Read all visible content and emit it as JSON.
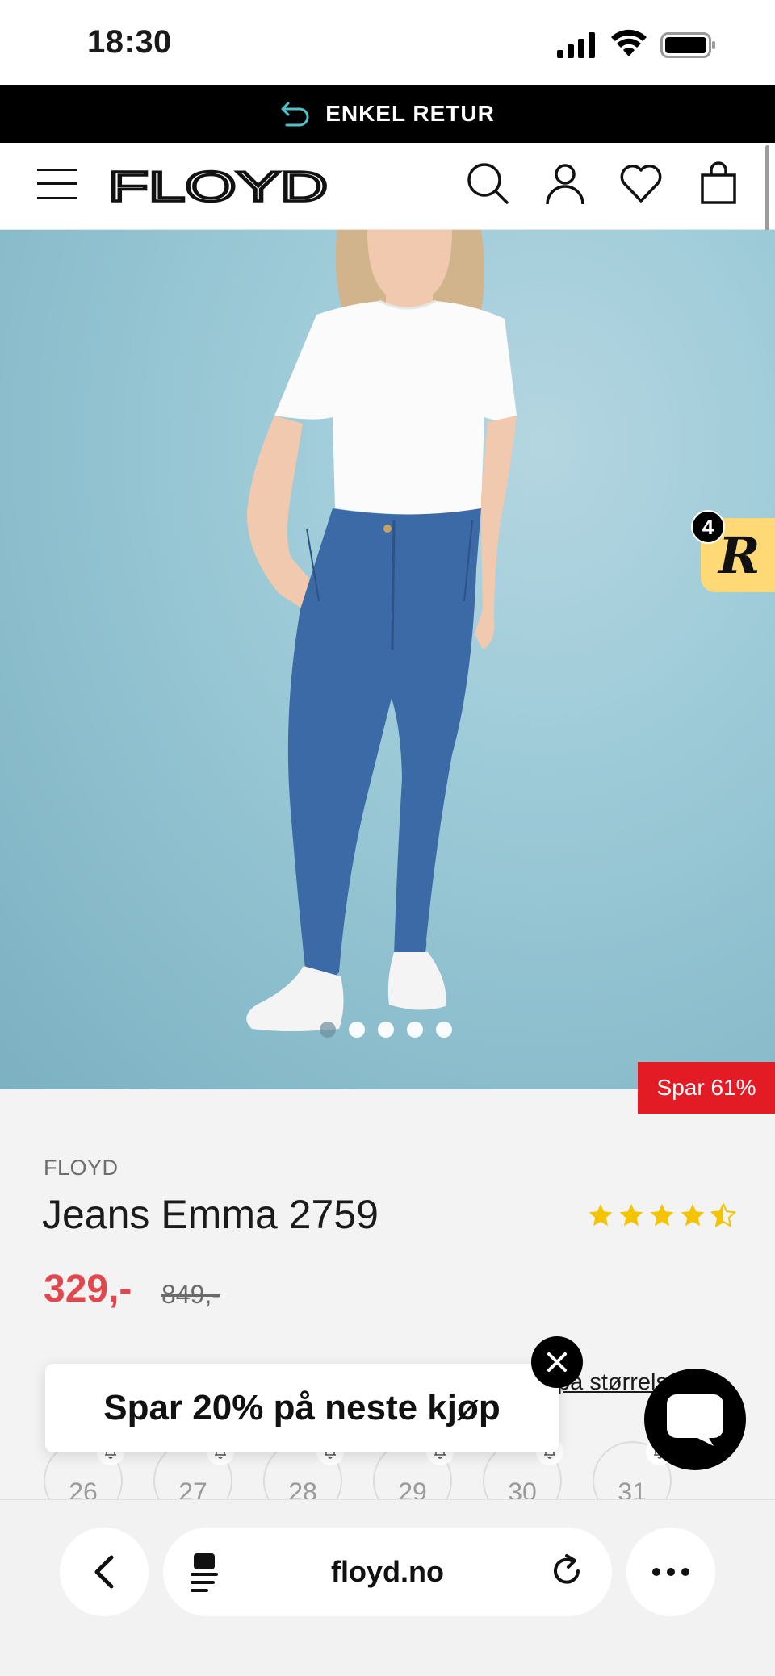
{
  "status_bar": {
    "time": "18:30"
  },
  "promo": {
    "text": "ENKEL RETUR"
  },
  "header": {
    "logo": "FLOYD"
  },
  "product": {
    "brand": "FLOYD",
    "title": "Jeans Emma 2759",
    "price": "329,-",
    "old_price": "849,-",
    "sale_badge": "Spar 61%",
    "rating": 4.5,
    "size_link": "på størrelse?",
    "sizes": [
      "26",
      "27",
      "28",
      "29",
      "30",
      "31"
    ]
  },
  "carousel": {
    "count": 5,
    "active": 0
  },
  "review_widget": {
    "count": "4",
    "letter": "R"
  },
  "popup": {
    "text": "Spar 20% på neste kjøp"
  },
  "browser": {
    "url": "floyd.no"
  },
  "colors": {
    "sale_red": "#e31b24",
    "price_red": "#e2474d",
    "star_yellow": "#f5c400",
    "review_yellow": "#ffd976"
  }
}
